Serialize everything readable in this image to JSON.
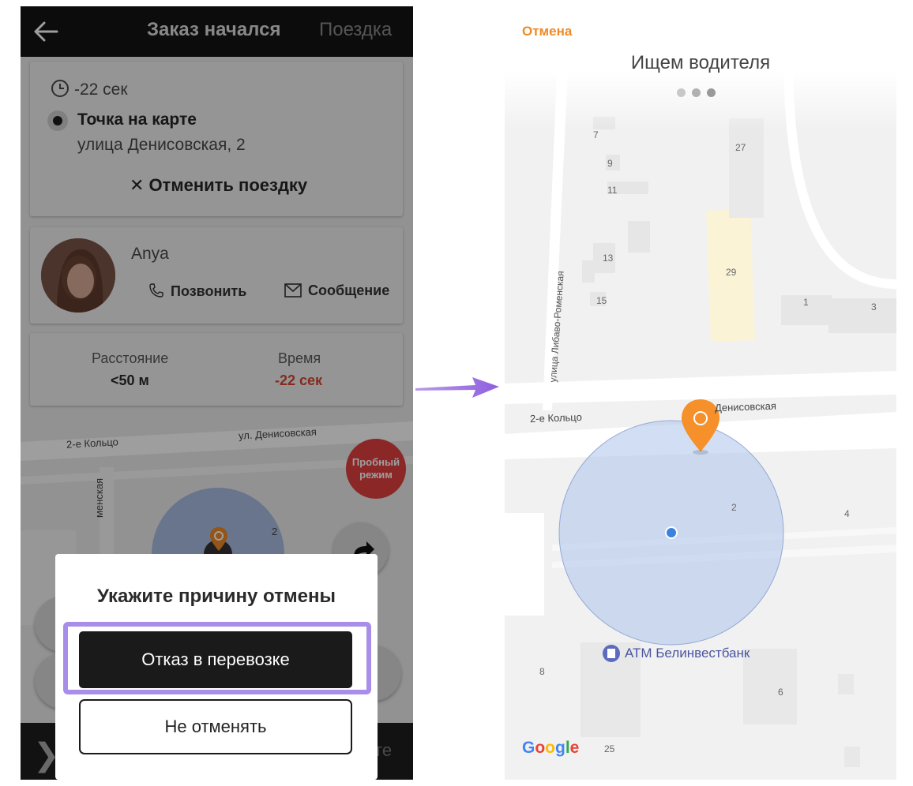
{
  "left_screen": {
    "header": {
      "title": "Заказ начался",
      "tab2": "Поездка"
    },
    "route": {
      "time": "-22 сек",
      "point_title": "Точка на карте",
      "address": "улица Денисовская, 2",
      "cancel_trip": "Отменить поездку"
    },
    "driver": {
      "name": "Anya",
      "call": "Позвонить",
      "message": "Сообщение"
    },
    "stats": {
      "distance_label": "Расстояние",
      "distance_value": "<50 м",
      "time_label": "Время",
      "time_value": "-22 сек"
    },
    "trial_badge": {
      "line1": "Пробный",
      "line2": "режим"
    },
    "map": {
      "street1": "2-е Кольцо",
      "street2": "ул. Денисовская",
      "street3": "менская",
      "house": "2"
    },
    "dialog": {
      "title": "Укажите причину отмены",
      "refuse_button": "Отказ в перевозке",
      "keep_button": "Не отменять"
    },
    "bottom_bar_tail": "те"
  },
  "right_screen": {
    "cancel_link": "Отмена",
    "title": "Ищем водителя",
    "map": {
      "street_vertical": "улица Либаво-Роменская",
      "street_left": "2-е Кольцо",
      "street_top": "Денисовская",
      "poi": "АТМ Белинвестбанк",
      "houses": [
        "7",
        "9",
        "11",
        "13",
        "15",
        "27",
        "29",
        "1",
        "3",
        "2",
        "4",
        "8",
        "6",
        "25"
      ]
    },
    "google_logo": [
      "G",
      "o",
      "o",
      "g",
      "l",
      "e"
    ]
  },
  "colors": {
    "accent_orange": "#f08a24",
    "highlight": "#a88ee8",
    "arrow": "#9b6fe3",
    "radius_fill": "#b4c8ec",
    "red": "#e04040"
  }
}
